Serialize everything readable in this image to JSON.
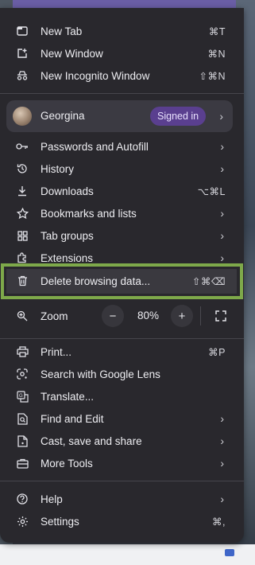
{
  "menu": {
    "items_top": [
      {
        "label": "New Tab",
        "shortcut": "⌘T",
        "icon": "new-tab-icon"
      },
      {
        "label": "New Window",
        "shortcut": "⌘N",
        "icon": "new-window-icon"
      },
      {
        "label": "New Incognito Window",
        "shortcut": "⇧⌘N",
        "icon": "incognito-icon"
      }
    ],
    "profile": {
      "name": "Georgina",
      "badge": "Signed in"
    },
    "items_mid": [
      {
        "label": "Passwords and Autofill",
        "icon": "key-icon"
      },
      {
        "label": "History",
        "icon": "history-icon"
      },
      {
        "label": "Downloads",
        "shortcut": "⌥⌘L",
        "icon": "download-icon"
      },
      {
        "label": "Bookmarks and lists",
        "icon": "star-icon"
      },
      {
        "label": "Tab groups",
        "icon": "tab-groups-icon"
      },
      {
        "label": "Extensions",
        "icon": "extensions-icon"
      },
      {
        "label": "Delete browsing data...",
        "shortcut": "⇧⌘⌫",
        "icon": "trash-icon"
      }
    ],
    "zoom": {
      "label": "Zoom",
      "value": "80%",
      "minus": "−",
      "plus": "+"
    },
    "items_bottom": [
      {
        "label": "Print...",
        "shortcut": "⌘P",
        "icon": "print-icon"
      },
      {
        "label": "Search with Google Lens",
        "icon": "lens-icon"
      },
      {
        "label": "Translate...",
        "icon": "translate-icon"
      },
      {
        "label": "Find and Edit",
        "icon": "find-icon"
      },
      {
        "label": "Cast, save and share",
        "icon": "cast-icon"
      },
      {
        "label": "More Tools",
        "icon": "toolbox-icon"
      }
    ],
    "items_footer": [
      {
        "label": "Help",
        "icon": "help-icon"
      },
      {
        "label": "Settings",
        "shortcut": "⌘,",
        "icon": "gear-icon"
      }
    ]
  },
  "colors": {
    "menu_bg": "#29282d",
    "highlight": "#7ea94a",
    "badge": "#5a3f8f"
  }
}
